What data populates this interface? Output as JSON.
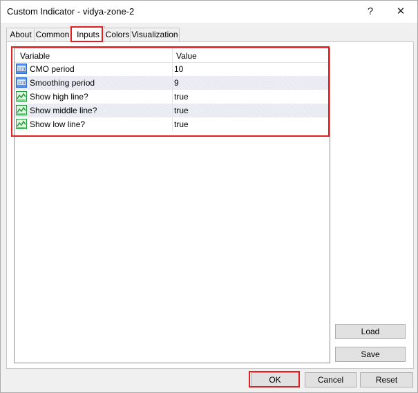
{
  "window": {
    "title": "Custom Indicator - vidya-zone-2",
    "help_glyph": "?",
    "close_glyph": "✕"
  },
  "tabs": [
    {
      "label": "About"
    },
    {
      "label": "Common"
    },
    {
      "label": "Inputs",
      "active": true
    },
    {
      "label": "Colors"
    },
    {
      "label": "Visualization"
    }
  ],
  "table": {
    "headers": {
      "variable": "Variable",
      "value": "Value"
    },
    "rows": [
      {
        "icon": "numeric-input-icon",
        "icon_text": "123",
        "variable": "CMO period",
        "value": "10"
      },
      {
        "icon": "numeric-input-icon",
        "icon_text": "123",
        "variable": "Smoothing period",
        "value": "9"
      },
      {
        "icon": "chart-line-icon",
        "variable": "Show high line?",
        "value": "true"
      },
      {
        "icon": "chart-line-icon",
        "variable": "Show middle line?",
        "value": "true"
      },
      {
        "icon": "chart-line-icon",
        "variable": "Show low line?",
        "value": "true"
      }
    ]
  },
  "side_buttons": {
    "load": "Load",
    "save": "Save"
  },
  "footer": {
    "ok": "OK",
    "cancel": "Cancel",
    "reset": "Reset"
  },
  "colors": {
    "highlight": "#e02020",
    "numeric_icon": "#2f6fd1",
    "chart_icon": "#1f9b3a"
  }
}
